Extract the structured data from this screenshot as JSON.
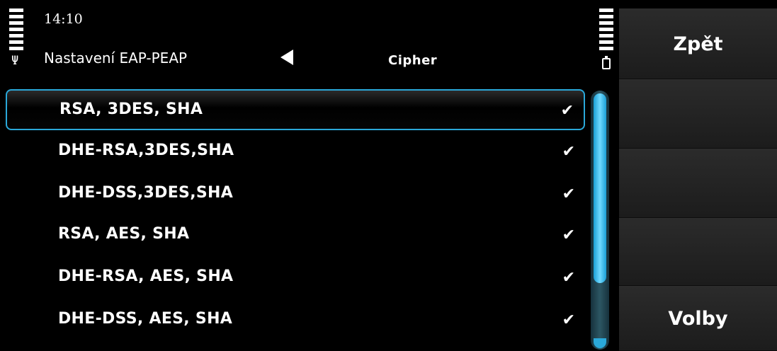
{
  "status": {
    "time": "14:10",
    "antenna_icon": "antenna-icon",
    "battery_icon": "battery-icon"
  },
  "header": {
    "title": "Nastavení EAP-PEAP",
    "tab": "Cipher",
    "nav_icon": "left-arrow-icon"
  },
  "list": {
    "items": [
      {
        "label": "RSA, 3DES, SHA",
        "checked": true,
        "selected": true
      },
      {
        "label": "DHE-RSA,3DES,SHA",
        "checked": true,
        "selected": false
      },
      {
        "label": "DHE-DSS,3DES,SHA",
        "checked": true,
        "selected": false
      },
      {
        "label": "RSA, AES, SHA",
        "checked": true,
        "selected": false
      },
      {
        "label": "DHE-RSA, AES, SHA",
        "checked": true,
        "selected": false
      },
      {
        "label": "DHE-DSS, AES, SHA",
        "checked": true,
        "selected": false
      }
    ],
    "check_glyph": "✔"
  },
  "softkeys": {
    "top": "Zpět",
    "bottom": "Volby"
  },
  "colors": {
    "accent": "#2aa8d9",
    "background": "#000000",
    "softkey_bg": "#1c1c1c"
  }
}
